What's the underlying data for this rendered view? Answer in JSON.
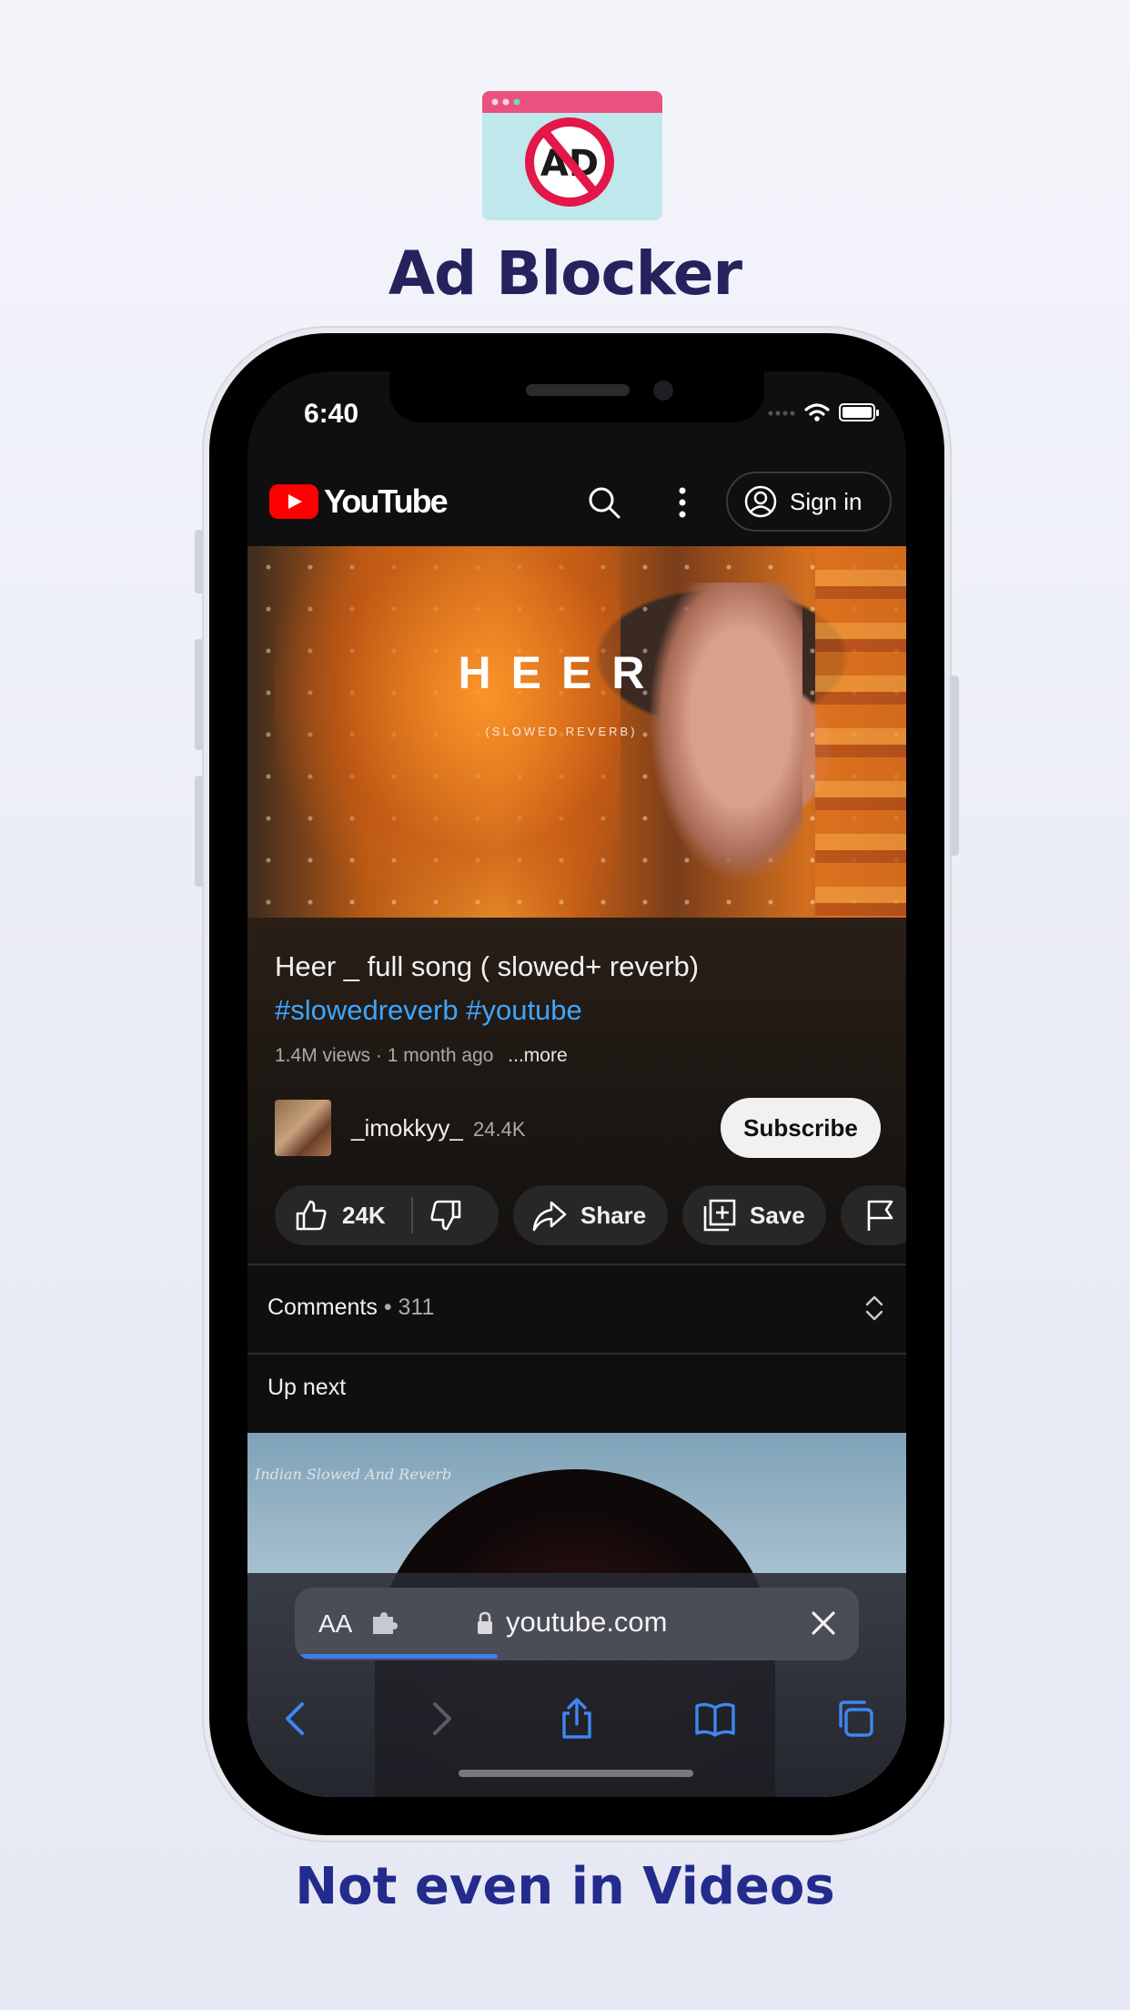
{
  "promo": {
    "title": "Ad Blocker",
    "subtitle": "Not even in Videos",
    "icon_text": "AD"
  },
  "status_bar": {
    "time": "6:40"
  },
  "youtube": {
    "logo_text": "YouTube",
    "sign_in_label": "Sign in",
    "video": {
      "thumbnail_title": "HEER",
      "thumbnail_subtitle": "(SLOWED REVERB)",
      "title": "Heer _ full song ( slowed+ reverb)",
      "hashtags": "#slowedreverb #youtube",
      "meta": "1.4M views · 1 month ago",
      "more_label": "...more"
    },
    "channel": {
      "name": "_imokkyy_",
      "subscribers": "24.4K",
      "subscribe_label": "Subscribe"
    },
    "actions": {
      "likes": "24K",
      "share_label": "Share",
      "save_label": "Save"
    },
    "comments": {
      "label": "Comments",
      "count": "• 311"
    },
    "up_next_label": "Up next",
    "next_thumbnail_watermark": "Indian Slowed And Reverb"
  },
  "safari": {
    "text_size_label": "AA",
    "url": "youtube.com",
    "load_progress": 0.35
  },
  "colors": {
    "promo_title": "#24235e",
    "promo_subtitle": "#232b8c",
    "yt_red": "#ff0000",
    "link_blue": "#3ea6ff",
    "safari_progress": "#3f7cf0"
  }
}
